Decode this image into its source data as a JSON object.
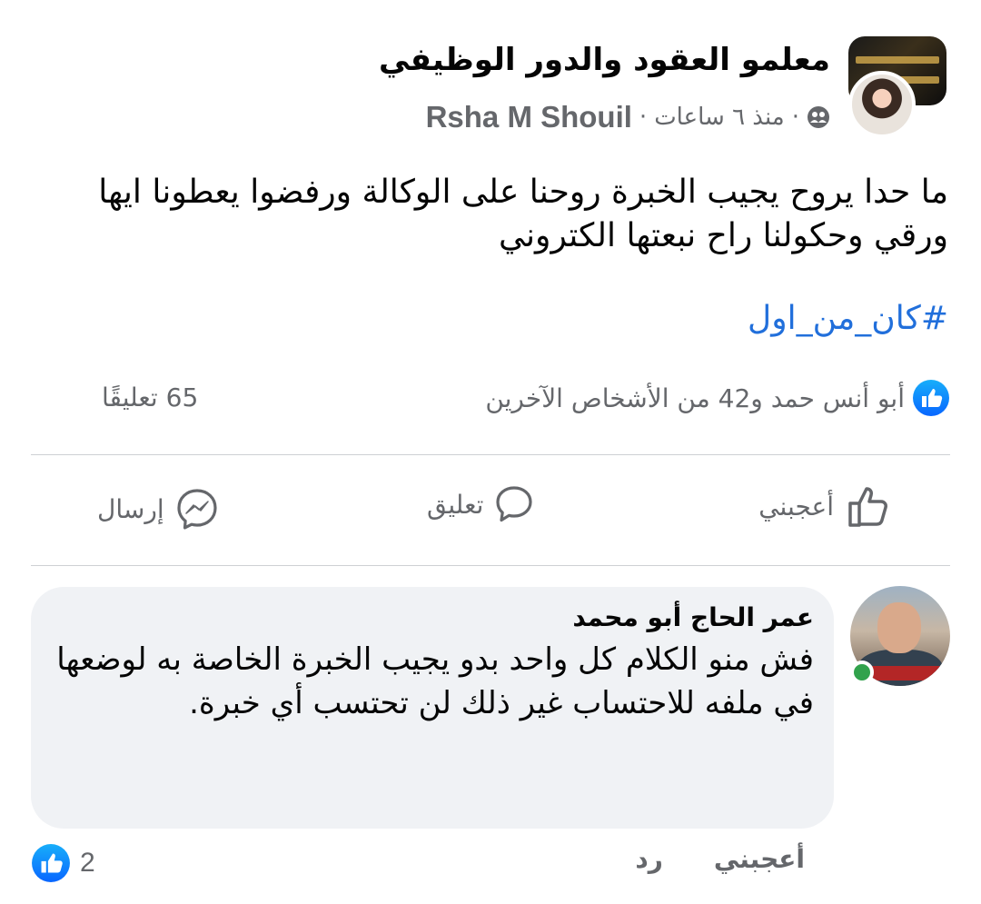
{
  "post": {
    "group_name": "معلمو العقود والدور الوظيفي",
    "author": "Rsha M Shouil",
    "time": "منذ ٦ ساعات",
    "separator": "·",
    "text": "ما حدا يروح يجيب الخبرة روحنا على الوكالة ورفضوا يعطونا ايها ورقي وحكولنا راح نبعتها الكتروني",
    "hashtag": "#كان_من_اول",
    "reactions_text": "أبو أنس حمد و42 من الأشخاص الآخرين",
    "comments_count": "65 تعليقًا"
  },
  "actions": {
    "like": "أعجبني",
    "comment": "تعليق",
    "send": "إرسال"
  },
  "comment": {
    "author": "عمر الحاج أبو محمد",
    "text": "فش منو الكلام كل واحد بدو يجيب الخبرة الخاصة به لوضعها في ملفه للاحتساب غير  ذلك لن تحتسب أي خبرة.",
    "like_label": "أعجبني",
    "reply_label": "رد",
    "reactions_count": "2"
  },
  "colors": {
    "facebook_blue": "#1877f2",
    "hashtag_blue": "#216fdb",
    "secondary_text": "#65676b",
    "bubble_bg": "#f0f2f5",
    "online_green": "#31a24c"
  },
  "icons": {
    "privacy": "group-members-icon",
    "reaction": "like-badge-icon",
    "like": "thumbs-up-icon",
    "comment": "speech-bubble-icon",
    "send": "messenger-icon"
  }
}
